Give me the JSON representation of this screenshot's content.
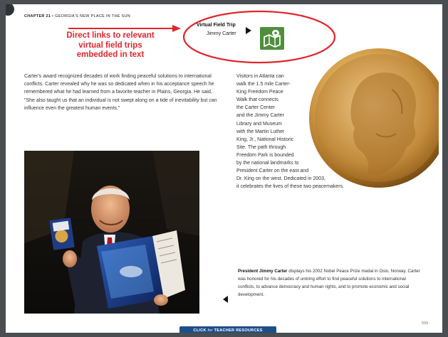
{
  "header": {
    "chapter_label": "CHAPTER 21",
    "separator": " • ",
    "chapter_title": "GEORGIA'S NEW PLACE IN THE SUN"
  },
  "callout": {
    "text": "Direct links to relevant virtual field trips embedded in text",
    "color": "#e1262d"
  },
  "virtual_field_trip": {
    "title": "Virtual Field Trip",
    "subject": "Jimmy Carter",
    "play_icon": "play-icon",
    "map_icon": "map-pin-icon",
    "icon_color": "#4f8f3c"
  },
  "body": {
    "paragraph": "Carter's award recognized decades of work finding peaceful solutions to international conflicts. Carter revealed why he was so dedicated when in his acceptance speech he remembered what he had learned from a favorite teacher in Plains, Georgia. He said, \"She also taught us that an individual is not swept along on a tide of inevitability but can influence even the greatest human events.\"",
    "side_lines": [
      "Visitors in Atlanta can",
      "walk the 1.5 mile Carter-",
      "King Freedom Peace",
      "Walk that connects",
      "the Carter Center",
      "and the Jimmy Carter",
      "Library and Museum",
      "with the Martin Luther",
      "King, Jr., National Historic",
      "Site. The path through",
      "Freedom Park is bounded",
      "by the national landmarks to",
      "President Carter on the east and",
      "Dr. King on the west. Dedicated in 2003,",
      "it celebrates the lives of these two peacemakers."
    ]
  },
  "caption": {
    "bold": "President Jimmy Carter",
    "text": " displays his 2002 Nobel Peace Prize medal in Oslo, Norway. Carter was honored for his decades of untiring effort to find peaceful solutions to international conflicts, to advance democracy and human rights, and to promote economic and social development."
  },
  "page_number": "599",
  "teacher_button": {
    "prefix": "CLICK ",
    "for_word": "for",
    "suffix": " TEACHER RESOURCES",
    "color": "#1d4f8a"
  }
}
